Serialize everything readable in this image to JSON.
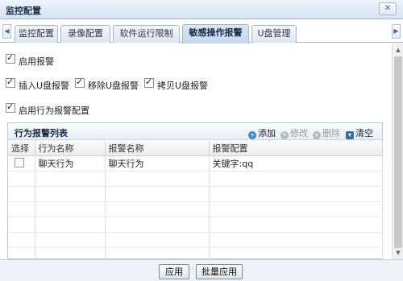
{
  "window": {
    "title": "监控配置",
    "close_symbol": "✕"
  },
  "tabs": [
    {
      "label": "监控配置",
      "active": false
    },
    {
      "label": "录像配置",
      "active": false
    },
    {
      "label": "软件运行限制",
      "active": false
    },
    {
      "label": "敏感操作报警",
      "active": true
    },
    {
      "label": "U盘管理",
      "active": false
    }
  ],
  "options": {
    "enable_alarm": {
      "label": "启用报警",
      "checked": true
    },
    "insert_usb": {
      "label": "插入U盘报警",
      "checked": true
    },
    "remove_usb": {
      "label": "移除U盘报警",
      "checked": true
    },
    "copy_usb": {
      "label": "拷贝U盘报警",
      "checked": true
    },
    "enable_behavior": {
      "label": "启用行为报警配置",
      "checked": true
    }
  },
  "behavior_panel": {
    "title": "行为报警列表",
    "toolbar": {
      "add": "添加",
      "edit": "修改",
      "delete": "删除",
      "clear": "清空"
    },
    "columns": [
      "选择",
      "行为名称",
      "报警名称",
      "报警配置"
    ],
    "rows": [
      {
        "behavior": "聊天行为",
        "alarm": "聊天行为",
        "config": "关键字:qq"
      }
    ]
  },
  "footer": {
    "apply": "应用",
    "batch_apply": "批量应用"
  },
  "icons": [
    "close-icon",
    "tab-scroll-left-icon",
    "tab-scroll-right-icon",
    "add-icon",
    "edit-icon",
    "delete-icon",
    "clear-icon"
  ],
  "colors": {
    "title_bar": "#d6e3f2",
    "active_tab": "#c5d7ec",
    "accent_blue": "#3c86cf"
  }
}
